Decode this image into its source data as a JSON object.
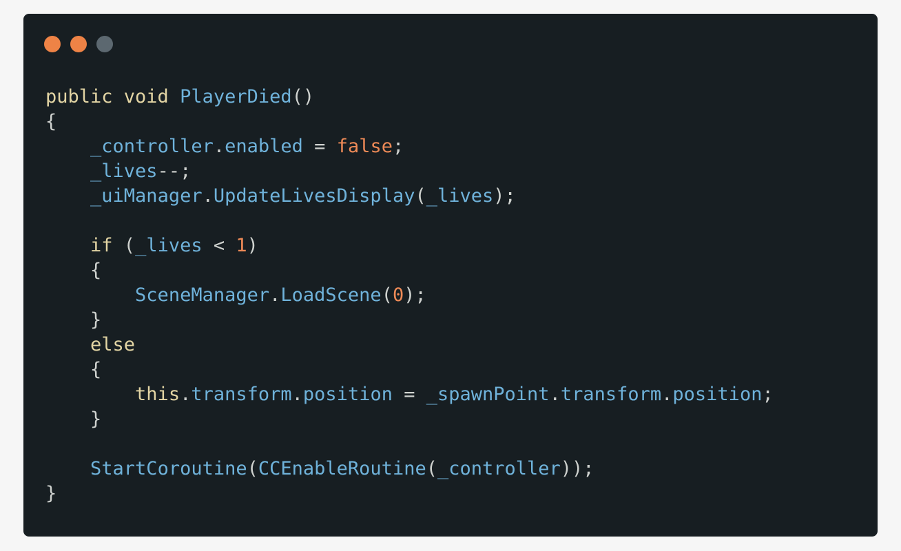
{
  "window": {
    "buttons": [
      {
        "name": "close-dot",
        "color": "#ee8346"
      },
      {
        "name": "minimize-dot",
        "color": "#ee8346"
      },
      {
        "name": "maximize-dot",
        "color": "#5c6870"
      }
    ]
  },
  "code": {
    "lines": [
      [
        [
          "kw",
          "public void "
        ],
        [
          "fn",
          "PlayerDied"
        ],
        [
          "punc",
          "()"
        ]
      ],
      [
        [
          "punc",
          "{"
        ]
      ],
      [
        [
          "plain",
          "    "
        ],
        [
          "id",
          "_controller"
        ],
        [
          "punc",
          "."
        ],
        [
          "id",
          "enabled"
        ],
        [
          "op",
          " = "
        ],
        [
          "lit",
          "false"
        ],
        [
          "punc",
          ";"
        ]
      ],
      [
        [
          "plain",
          "    "
        ],
        [
          "id",
          "_lives"
        ],
        [
          "punc",
          "--;"
        ]
      ],
      [
        [
          "plain",
          "    "
        ],
        [
          "id",
          "_uiManager"
        ],
        [
          "punc",
          "."
        ],
        [
          "fn",
          "UpdateLivesDisplay"
        ],
        [
          "punc",
          "("
        ],
        [
          "id",
          "_lives"
        ],
        [
          "punc",
          ");"
        ]
      ],
      [],
      [
        [
          "plain",
          "    "
        ],
        [
          "kw",
          "if"
        ],
        [
          "punc",
          " ("
        ],
        [
          "id",
          "_lives"
        ],
        [
          "op",
          " < "
        ],
        [
          "lit",
          "1"
        ],
        [
          "punc",
          ")"
        ]
      ],
      [
        [
          "plain",
          "    "
        ],
        [
          "punc",
          "{"
        ]
      ],
      [
        [
          "plain",
          "        "
        ],
        [
          "fn",
          "SceneManager"
        ],
        [
          "punc",
          "."
        ],
        [
          "fn",
          "LoadScene"
        ],
        [
          "punc",
          "("
        ],
        [
          "lit",
          "0"
        ],
        [
          "punc",
          ");"
        ]
      ],
      [
        [
          "plain",
          "    "
        ],
        [
          "punc",
          "}"
        ]
      ],
      [
        [
          "plain",
          "    "
        ],
        [
          "kw",
          "else"
        ]
      ],
      [
        [
          "plain",
          "    "
        ],
        [
          "punc",
          "{"
        ]
      ],
      [
        [
          "plain",
          "        "
        ],
        [
          "kw",
          "this"
        ],
        [
          "punc",
          "."
        ],
        [
          "id",
          "transform"
        ],
        [
          "punc",
          "."
        ],
        [
          "id",
          "position"
        ],
        [
          "op",
          " = "
        ],
        [
          "id",
          "_spawnPoint"
        ],
        [
          "punc",
          "."
        ],
        [
          "id",
          "transform"
        ],
        [
          "punc",
          "."
        ],
        [
          "id",
          "position"
        ],
        [
          "punc",
          ";"
        ]
      ],
      [
        [
          "plain",
          "    "
        ],
        [
          "punc",
          "}"
        ]
      ],
      [],
      [
        [
          "plain",
          "    "
        ],
        [
          "fn",
          "StartCoroutine"
        ],
        [
          "punc",
          "("
        ],
        [
          "fn",
          "CCEnableRoutine"
        ],
        [
          "punc",
          "("
        ],
        [
          "id",
          "_controller"
        ],
        [
          "punc",
          "));"
        ]
      ],
      [
        [
          "punc",
          "}"
        ]
      ]
    ]
  }
}
